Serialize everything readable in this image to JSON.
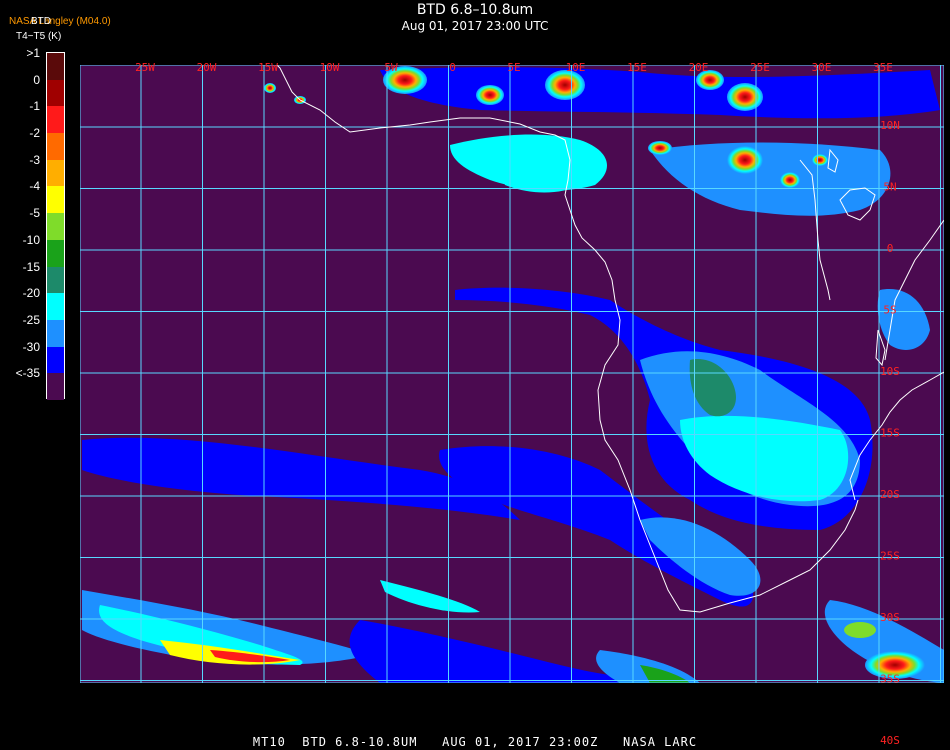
{
  "header": {
    "title": "BTD 6.8–10.8um",
    "subtitle": "Aug 01, 2017 23:00 UTC",
    "credit": "NASA Langley (M04.0)",
    "legend_title_a": "BTD",
    "legend_title_b": "T4−T5 (K)"
  },
  "colorbar": {
    "bins": [
      {
        "label": ">1",
        "color": "#5a0a0a"
      },
      {
        "label": "0",
        "color": "#a00000"
      },
      {
        "label": "-1",
        "color": "#ff1a1a"
      },
      {
        "label": "-2",
        "color": "#ff6a00"
      },
      {
        "label": "-3",
        "color": "#ffae00"
      },
      {
        "label": "-4",
        "color": "#ffff00"
      },
      {
        "label": "-5",
        "color": "#7fdc2a"
      },
      {
        "label": "-10",
        "color": "#1aa21a"
      },
      {
        "label": "-15",
        "color": "#1d8a6a"
      },
      {
        "label": "-20",
        "color": "#00ffff"
      },
      {
        "label": "-25",
        "color": "#1e90ff"
      },
      {
        "label": "-30",
        "color": "#0000ff"
      },
      {
        "label": "<-35",
        "color": "#4b0a50"
      }
    ]
  },
  "map": {
    "background_color": "#4b0a50",
    "grid_color": "#58d8ff",
    "coast_color": "#ffffff",
    "lon_labels": [
      "25W",
      "20W",
      "15W",
      "10W",
      "5W",
      "0",
      "5E",
      "10E",
      "15E",
      "20E",
      "25E",
      "30E",
      "35E"
    ],
    "lat_labels": [
      "10N",
      "5N",
      "0",
      "5S",
      "10S",
      "15S",
      "20S",
      "25S",
      "30S",
      "35S",
      "40S"
    ]
  },
  "footer": {
    "text": "MT10  BTD 6.8-10.8UM   AUG 01, 2017 23:00Z   NASA LARC"
  }
}
